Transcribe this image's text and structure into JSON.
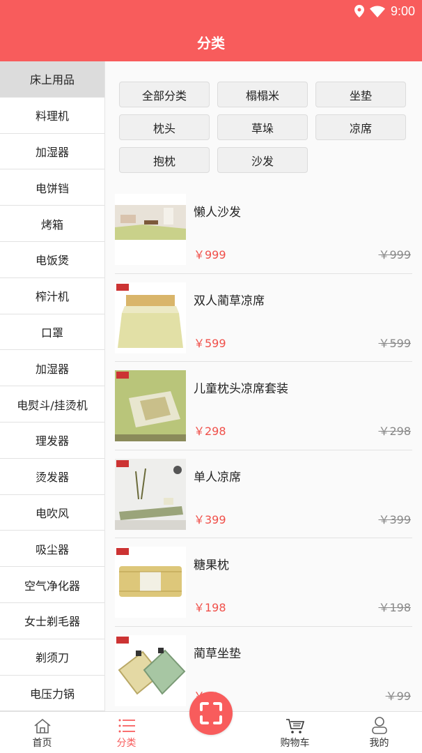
{
  "status": {
    "time": "9:00"
  },
  "header": {
    "title": "分类"
  },
  "sidebar": {
    "items": [
      {
        "label": "床上用品",
        "active": true
      },
      {
        "label": "料理机"
      },
      {
        "label": "加湿器"
      },
      {
        "label": "电饼铛"
      },
      {
        "label": "烤箱"
      },
      {
        "label": "电饭煲"
      },
      {
        "label": "榨汁机"
      },
      {
        "label": "口罩"
      },
      {
        "label": "加湿器"
      },
      {
        "label": "电熨斗/挂烫机"
      },
      {
        "label": "理发器"
      },
      {
        "label": "烫发器"
      },
      {
        "label": "电吹风"
      },
      {
        "label": "吸尘器"
      },
      {
        "label": "空气净化器"
      },
      {
        "label": "女士剃毛器"
      },
      {
        "label": "剃须刀"
      },
      {
        "label": "电压力锅"
      }
    ]
  },
  "filters": [
    "全部分类",
    "榻榻米",
    "坐垫",
    "枕头",
    "草垛",
    "凉席",
    "抱枕",
    "沙发"
  ],
  "products": [
    {
      "name": "懒人沙发",
      "price": "￥999",
      "original_price": "￥999",
      "image": "tatami-room-photo"
    },
    {
      "name": "双人蔺草凉席",
      "price": "￥599",
      "original_price": "￥599",
      "image": "double-mat-photo"
    },
    {
      "name": "儿童枕头凉席套装",
      "price": "￥298",
      "original_price": "￥298",
      "image": "pillow-mat-photo"
    },
    {
      "name": "单人凉席",
      "price": "￥399",
      "original_price": "￥399",
      "image": "single-mat-photo"
    },
    {
      "name": "糖果枕",
      "price": "￥198",
      "original_price": "￥198",
      "image": "candy-pillow-photo"
    },
    {
      "name": "蔺草坐垫",
      "price": "￥99",
      "original_price": "￥99",
      "image": "seat-cushion-photo"
    }
  ],
  "tabbar": {
    "home": "首页",
    "category": "分类",
    "cart": "购物车",
    "mine": "我的"
  },
  "colors": {
    "accent": "#f85c5c",
    "price": "#f0504a"
  }
}
